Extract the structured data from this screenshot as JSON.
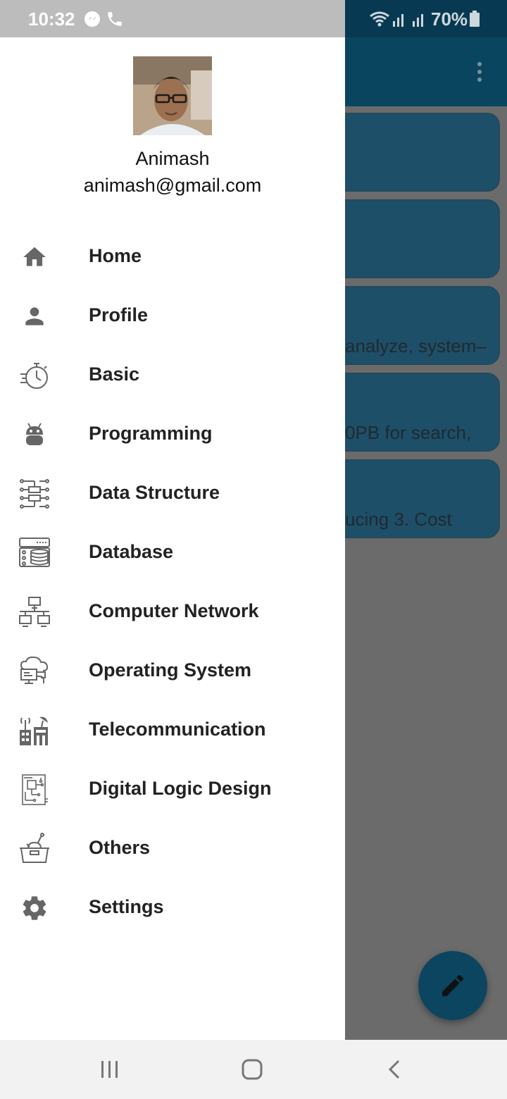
{
  "status_bar": {
    "time": "10:32",
    "battery": "70%"
  },
  "drawer": {
    "user_name": "Animash",
    "user_email": "animash@gmail.com",
    "items": [
      {
        "label": "Home",
        "icon": "home-icon"
      },
      {
        "label": "Profile",
        "icon": "person-icon"
      },
      {
        "label": "Basic",
        "icon": "stopwatch-icon"
      },
      {
        "label": "Programming",
        "icon": "android-icon"
      },
      {
        "label": "Data Structure",
        "icon": "data-structure-icon"
      },
      {
        "label": "Database",
        "icon": "database-icon"
      },
      {
        "label": "Computer Network",
        "icon": "network-icon"
      },
      {
        "label": "Operating System",
        "icon": "operating-system-icon"
      },
      {
        "label": "Telecommunication",
        "icon": "telecom-tower-icon"
      },
      {
        "label": "Digital Logic Design",
        "icon": "circuit-board-icon"
      },
      {
        "label": "Others",
        "icon": "toolbox-icon"
      },
      {
        "label": "Settings",
        "icon": "gear-icon"
      }
    ]
  },
  "background": {
    "cards": [
      {
        "text": ""
      },
      {
        "text": ""
      },
      {
        "text": "analyze, system–"
      },
      {
        "text": "0PB for search,"
      },
      {
        "text": "ucing 3. Cost"
      }
    ]
  },
  "colors": {
    "app_bar": "#0a4560",
    "scrim": "#6b6b6b",
    "card": "#1e4f68",
    "drawer_bg": "#ffffff",
    "icon_gray": "#666666"
  }
}
